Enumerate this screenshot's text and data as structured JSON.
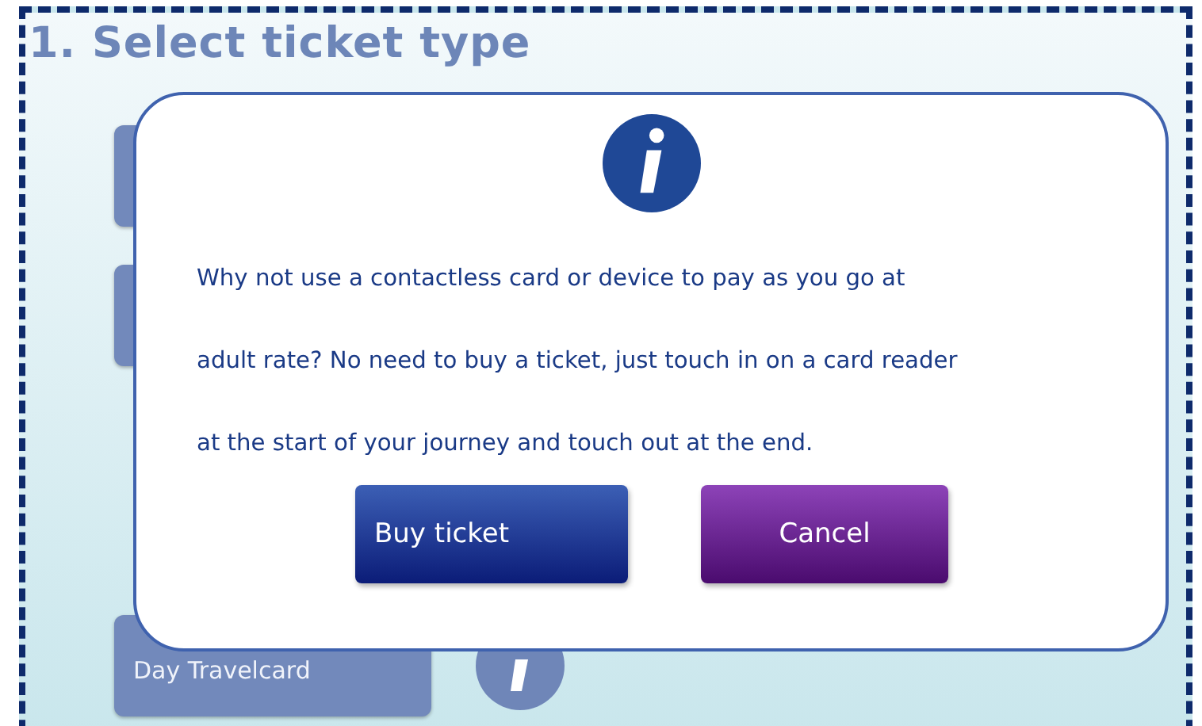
{
  "page": {
    "title": "1. Select ticket type"
  },
  "tickets": [
    {
      "label": "Day Travelcard"
    }
  ],
  "dialog": {
    "message_lines": [
      "Why not use a contactless card or device to pay as you go at",
      "adult rate? No need to buy a ticket, just touch in on a card reader",
      "at the start of your journey and touch out at the end."
    ],
    "buttons": [
      {
        "label": "Buy ticket",
        "kind": "primary"
      },
      {
        "label": "Cancel",
        "kind": "secondary"
      }
    ]
  }
}
